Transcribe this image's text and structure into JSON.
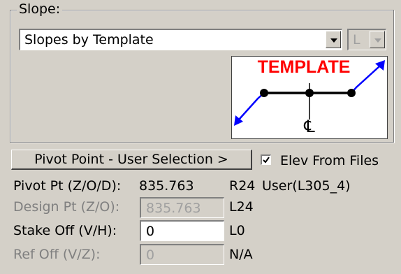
{
  "slope_group": {
    "legend": "Slope:",
    "combo_value": "Slopes by Template",
    "side_combo_value": "L",
    "template_label": "TEMPLATE",
    "centerline_symbol": "℄"
  },
  "pivot_button": {
    "label": "Pivot Point - User Selection >"
  },
  "elev_checkbox": {
    "label": "Elev From Files",
    "checked": true
  },
  "rows": {
    "pivot": {
      "label": "Pivot Pt (Z/O/D):",
      "value": "835.763",
      "code": "R24",
      "extra": "User(L305_4)"
    },
    "design": {
      "label": "Design Pt (Z/O):",
      "value": "835.763",
      "code": "L24"
    },
    "stake": {
      "label": "Stake Off (V/H):",
      "value": "0",
      "code": "L0"
    },
    "ref": {
      "label": "Ref Off (V/Z):",
      "value": "0",
      "code": "N/A"
    }
  },
  "colors": {
    "template_text": "#ff0000",
    "slope_lines": "#0000ff",
    "background": "#d4d0c8"
  }
}
